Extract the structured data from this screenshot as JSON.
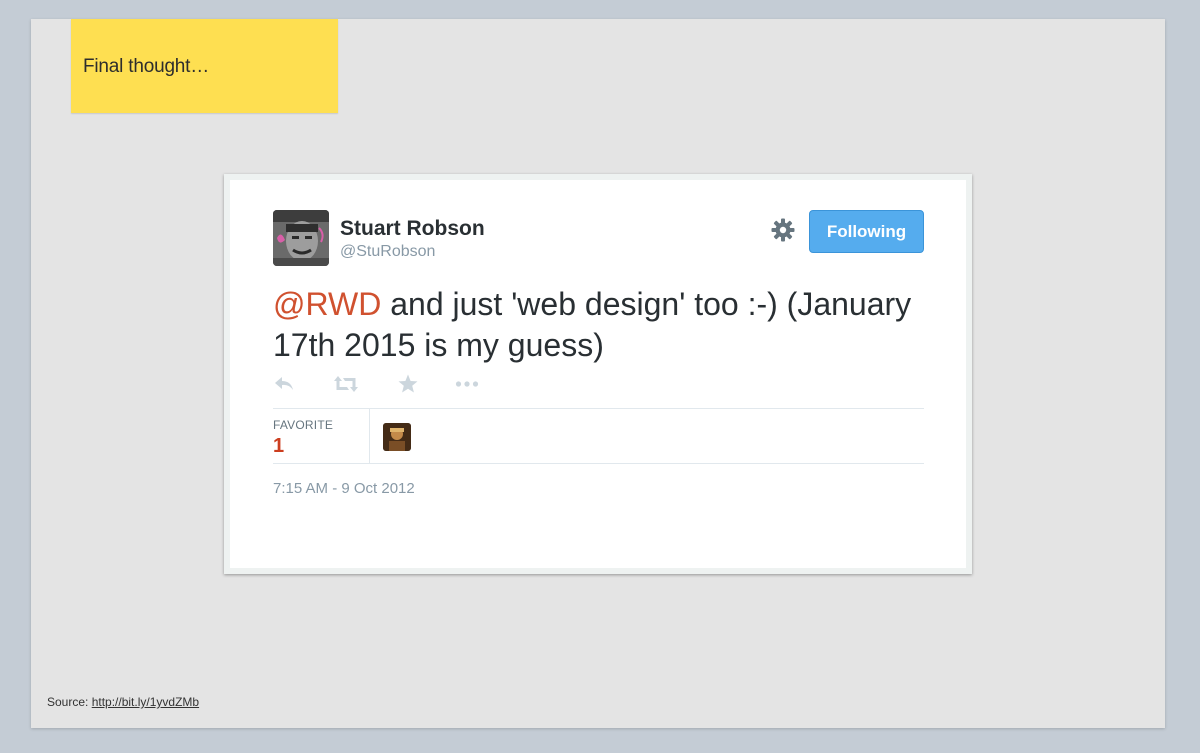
{
  "slide": {
    "sticky_note": "Final thought…",
    "source_label": "Source:",
    "source_link": "http://bit.ly/1yvdZMb"
  },
  "tweet": {
    "author_name": "Stuart Robson",
    "author_handle": "@StuRobson",
    "follow_button": "Following",
    "mention": "@RWD",
    "text": " and just 'web design' too :-) (January 17th 2015 is my guess)",
    "favorite_label": "FAVORITE",
    "favorite_count": "1",
    "timestamp": "7:15 AM - 9 Oct 2012",
    "icons": [
      "reply-icon",
      "retweet-icon",
      "favorite-star-icon",
      "more-icon",
      "gear-icon"
    ]
  },
  "colors": {
    "sticky": "#fedf51",
    "follow_button": "#55acee",
    "mention": "#d0512f",
    "favorite_count": "#cc3e1f"
  }
}
